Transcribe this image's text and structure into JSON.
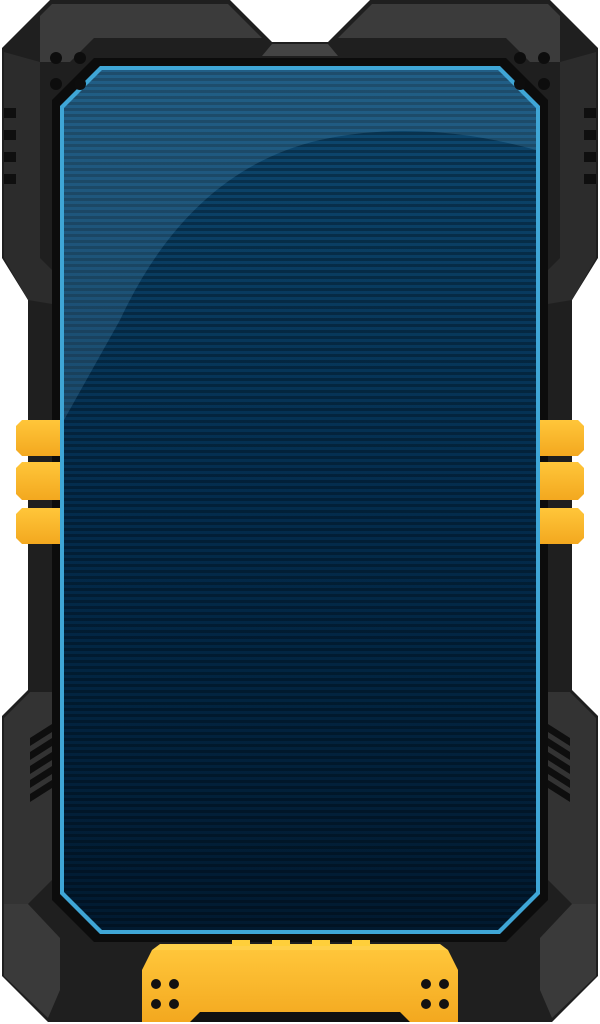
{
  "device": {
    "kind": "rugged-device-frame",
    "screen_state": "blank",
    "colors": {
      "frame_outer": "#1f1f1f",
      "frame_mid": "#2a2a2a",
      "frame_top": "#3a3a3a",
      "frame_highlight": "#4a4a4a",
      "accent": "#fdb92b",
      "accent_dark": "#e89a12",
      "screen_border": "#3fa6d6",
      "screen_top": "#0d4468",
      "screen_bottom": "#011a30"
    },
    "side_buttons": {
      "left_count": 3,
      "right_count": 3
    },
    "bottom_dock": {
      "screw_holes_per_side": 4
    },
    "icons": [
      "speaker-grill-icon",
      "vent-slits-icon",
      "screw-hole-icon"
    ]
  }
}
